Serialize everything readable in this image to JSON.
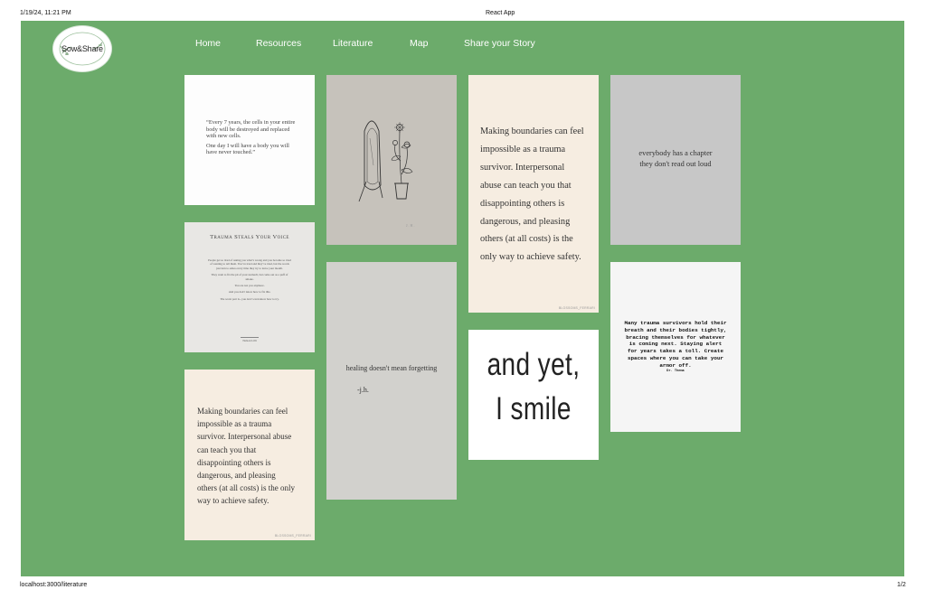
{
  "print": {
    "datetime": "1/19/24, 11:21 PM",
    "title": "React App",
    "url": "localhost:3000/literature",
    "page_count": "1/2"
  },
  "brand": {
    "logo_text": "Sow&Share"
  },
  "nav": {
    "items": [
      {
        "label": "Home"
      },
      {
        "label": "Resources"
      },
      {
        "label": "Literature"
      },
      {
        "label": "Map"
      },
      {
        "label": "Share your Story"
      }
    ]
  },
  "colors": {
    "background": "#6cab6b",
    "nav_text": "#ffffff"
  },
  "cards": {
    "cells_quote": {
      "line1": "“Every 7 years, the cells in your entire body will be destroyed and replaced with new cells.",
      "line2": "One day I will have a body you will have never touched.”"
    },
    "trauma_voice": {
      "title": "Trauma Steals Your Voice",
      "p1": "People get so tired of asking you what’s wrong and you become so tired of wanting to tell them. You’ve tried and they’ve tried, but the words just turn to ashes every time they try to leave your mouth.",
      "p2": "They want to fix the pit of your stomach, but come out as a puff of smoke.",
      "p3": "You are not you anymore.",
      "p4": "And you don’t know how to fix this.",
      "p5": "The worst part is...you don’t even know how to try.",
      "author": "Nelson Lilli"
    },
    "boundaries_small": {
      "text": "Making boundaries can feel impossible as a trauma survivor. Interpersonal abuse can teach you that disappointing others is dangerous, and pleasing others (at all costs) is the only way to achieve safety.",
      "credit": "BLOSSOMS_FERRARI"
    },
    "drawing": {
      "signature": "J.H."
    },
    "healing": {
      "text": "healing doesn't mean forgetting",
      "author": "-j.h."
    },
    "boundaries_tall": {
      "text": "Making boundaries can feel impossible as a trauma survivor. Interpersonal abuse can teach you that disappointing others is dangerous, and pleasing others (at all costs) is the only way to achieve safety.",
      "credit": "BLOSSOMS_FERRARI"
    },
    "smile": {
      "line1": "and yet,",
      "line2": "I smile"
    },
    "chapter": {
      "line1": "everybody has a chapter",
      "line2": "they don't read out loud"
    },
    "armor": {
      "text": "Many trauma survivors hold their breath and their bodies tightly, bracing themselves for whatever is coming next. Staying alert for years takes a toll. Create spaces where you can take your armor off.",
      "author": "Dr. Thema"
    }
  }
}
